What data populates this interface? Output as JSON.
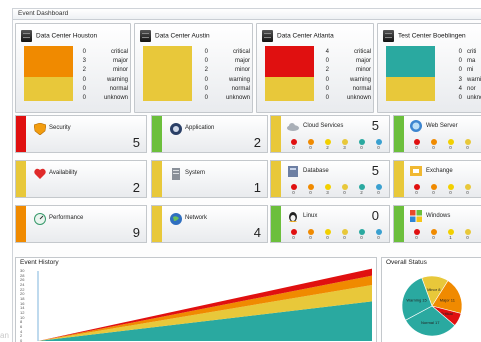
{
  "window": {
    "title": "Event Dashboard"
  },
  "colors": {
    "critical": "#e01010",
    "major": "#f08a00",
    "minor": "#f2d000",
    "warning": "#e8c83a",
    "normal": "#2aa9a0",
    "unknown": "#3aa0d0",
    "ok_green": "#6cbf3c"
  },
  "status_labels": [
    "critical",
    "major",
    "minor",
    "warning",
    "normal",
    "unknown"
  ],
  "datacenters": [
    {
      "name": "Data Center Houston",
      "counts": [
        "0",
        "3",
        "2",
        "0",
        "0",
        "0"
      ],
      "top_color": "#f08a00",
      "bottom_color": "#e8c83a"
    },
    {
      "name": "Data Center Austin",
      "counts": [
        "0",
        "0",
        "2",
        "0",
        "0",
        "0"
      ],
      "top_color": "#e8c83a",
      "bottom_color": "#e8c83a"
    },
    {
      "name": "Data Center Atlanta",
      "counts": [
        "4",
        "0",
        "2",
        "0",
        "0",
        "0"
      ],
      "top_color": "#e01010",
      "bottom_color": "#e8c83a"
    },
    {
      "name": "Test Center Boeblingen",
      "counts": [
        "0",
        "0",
        "0",
        "3",
        "4",
        "0"
      ],
      "top_color": "#2aa9a0",
      "bottom_color": "#e8c83a",
      "labels_visible": [
        "criti",
        "ma",
        "mi",
        "warni",
        "nor",
        "unkno"
      ]
    }
  ],
  "tiles": [
    {
      "name": "Security",
      "value": "5",
      "strip": "#e01010",
      "icon": "shield-icon"
    },
    {
      "name": "Application",
      "value": "2",
      "strip": "#6cbf3c",
      "icon": "application-icon"
    },
    {
      "name": "Availability",
      "value": "2",
      "strip": "#e8c83a",
      "icon": "heart-icon"
    },
    {
      "name": "System",
      "value": "1",
      "strip": "#e8c83a",
      "icon": "server-icon"
    },
    {
      "name": "Performance",
      "value": "9",
      "strip": "#f08a00",
      "icon": "gauge-icon"
    },
    {
      "name": "Network",
      "value": "4",
      "strip": "#e8c83a",
      "icon": "globe-icon"
    }
  ],
  "service_tiles": [
    {
      "name": "Cloud Services",
      "value": "5",
      "strip": "#e8c83a",
      "icon": "cloud-icon",
      "minis": [
        "0",
        "0",
        "2",
        "3",
        "0",
        "0"
      ]
    },
    {
      "name": "Web Server",
      "value": "",
      "strip": "#6cbf3c",
      "icon": "web-server-icon",
      "minis": [
        "0",
        "0",
        "0",
        "0",
        "0",
        "0"
      ]
    },
    {
      "name": "Database",
      "value": "5",
      "strip": "#e8c83a",
      "icon": "database-icon",
      "minis": [
        "0",
        "0",
        "3",
        "0",
        "2",
        "0"
      ]
    },
    {
      "name": "Exchange",
      "value": "",
      "strip": "#e8c83a",
      "icon": "exchange-icon",
      "minis": [
        "0",
        "0",
        "0",
        "0",
        "0",
        "0"
      ]
    },
    {
      "name": "Linux",
      "value": "0",
      "strip": "#6cbf3c",
      "icon": "linux-icon",
      "minis": [
        "0",
        "0",
        "0",
        "0",
        "0",
        "0"
      ]
    },
    {
      "name": "Windows",
      "value": "",
      "strip": "#6cbf3c",
      "icon": "windows-icon",
      "minis": [
        "0",
        "0",
        "1",
        "0",
        "0",
        "0"
      ]
    }
  ],
  "event_history": {
    "title": "Event History"
  },
  "overall_status": {
    "title": "Overall Status",
    "slice_labels": [
      "Minor 8",
      "Major 11",
      "Critical",
      "Normal 17",
      "Warning 15"
    ]
  },
  "chart_data": [
    {
      "type": "area",
      "title": "Event History",
      "stacked": true,
      "ytick_labels": [
        "30",
        "28",
        "26",
        "24",
        "22",
        "20",
        "18",
        "16",
        "14",
        "12",
        "10",
        "8",
        "6",
        "4",
        "2",
        "0"
      ],
      "x": [
        0,
        1
      ],
      "series": [
        {
          "color": "#2aa9a0",
          "values": [
            0,
            17
          ]
        },
        {
          "color": "#e8c83a",
          "values": [
            0,
            7
          ]
        },
        {
          "color": "#f08a00",
          "values": [
            0,
            4
          ]
        },
        {
          "color": "#e01010",
          "values": [
            0,
            3
          ]
        }
      ]
    },
    {
      "type": "pie",
      "title": "Overall Status",
      "labels": [
        "Minor 8",
        "Major 11",
        "Critical",
        "Normal 17",
        "Warning 15"
      ],
      "values": [
        8,
        11,
        4,
        17,
        15
      ],
      "colors": [
        "#e8c83a",
        "#f08a00",
        "#e01010",
        "#2aa9a0",
        "#2aa9a0"
      ]
    }
  ],
  "watermark": "an"
}
